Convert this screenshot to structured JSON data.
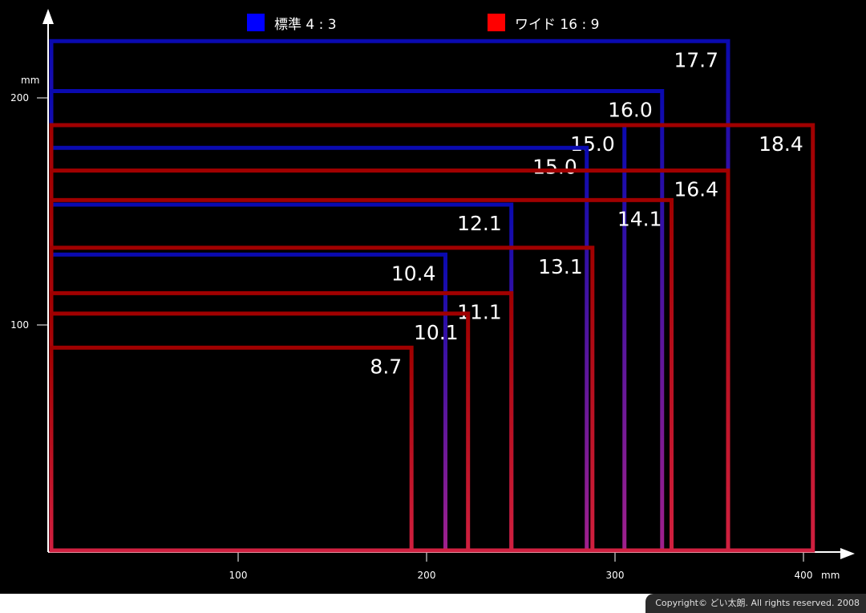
{
  "legend": [
    {
      "label": "標準 4 : 3",
      "color": "#0000ff"
    },
    {
      "label": "ワイド 16 : 9",
      "color": "#ff0000"
    }
  ],
  "footer": {
    "copyright": "Copyright© どい太朗. All rights reserved. 2008"
  },
  "chart_data": {
    "type": "rectangles",
    "x_unit_label": "mm",
    "y_unit_label": "mm",
    "xlim": [
      0,
      420
    ],
    "ylim": [
      0,
      245
    ],
    "x_ticks": [
      {
        "value": 100,
        "label": "100"
      },
      {
        "value": 200,
        "label": "200"
      },
      {
        "value": 300,
        "label": "300"
      },
      {
        "value": 400,
        "label": "400"
      }
    ],
    "y_ticks": [
      {
        "value": 100,
        "label": "100"
      },
      {
        "value": 200,
        "label": "200"
      }
    ],
    "series": [
      {
        "name": "標準 4 : 3",
        "aspect": "4:3",
        "rectangles": [
          {
            "label": "17.7",
            "width": 360,
            "height": 225
          },
          {
            "label": "16.0",
            "width": 325,
            "height": 203
          },
          {
            "label": "15.0",
            "width": 305,
            "height": 188
          },
          {
            "label": "15.0",
            "width": 285,
            "height": 178
          },
          {
            "label": "12.1",
            "width": 245,
            "height": 153
          },
          {
            "label": "10.4",
            "width": 210,
            "height": 131
          }
        ]
      },
      {
        "name": "ワイド 16 : 9",
        "aspect": "16:9",
        "rectangles": [
          {
            "label": "18.4",
            "width": 405,
            "height": 188
          },
          {
            "label": "16.4",
            "width": 360,
            "height": 168
          },
          {
            "label": "14.1",
            "width": 330,
            "height": 155
          },
          {
            "label": "13.1",
            "width": 288,
            "height": 134
          },
          {
            "label": "11.1",
            "width": 245,
            "height": 114
          },
          {
            "label": "10.1",
            "width": 222,
            "height": 105
          },
          {
            "label": "8.7",
            "width": 192,
            "height": 90
          }
        ]
      }
    ]
  }
}
